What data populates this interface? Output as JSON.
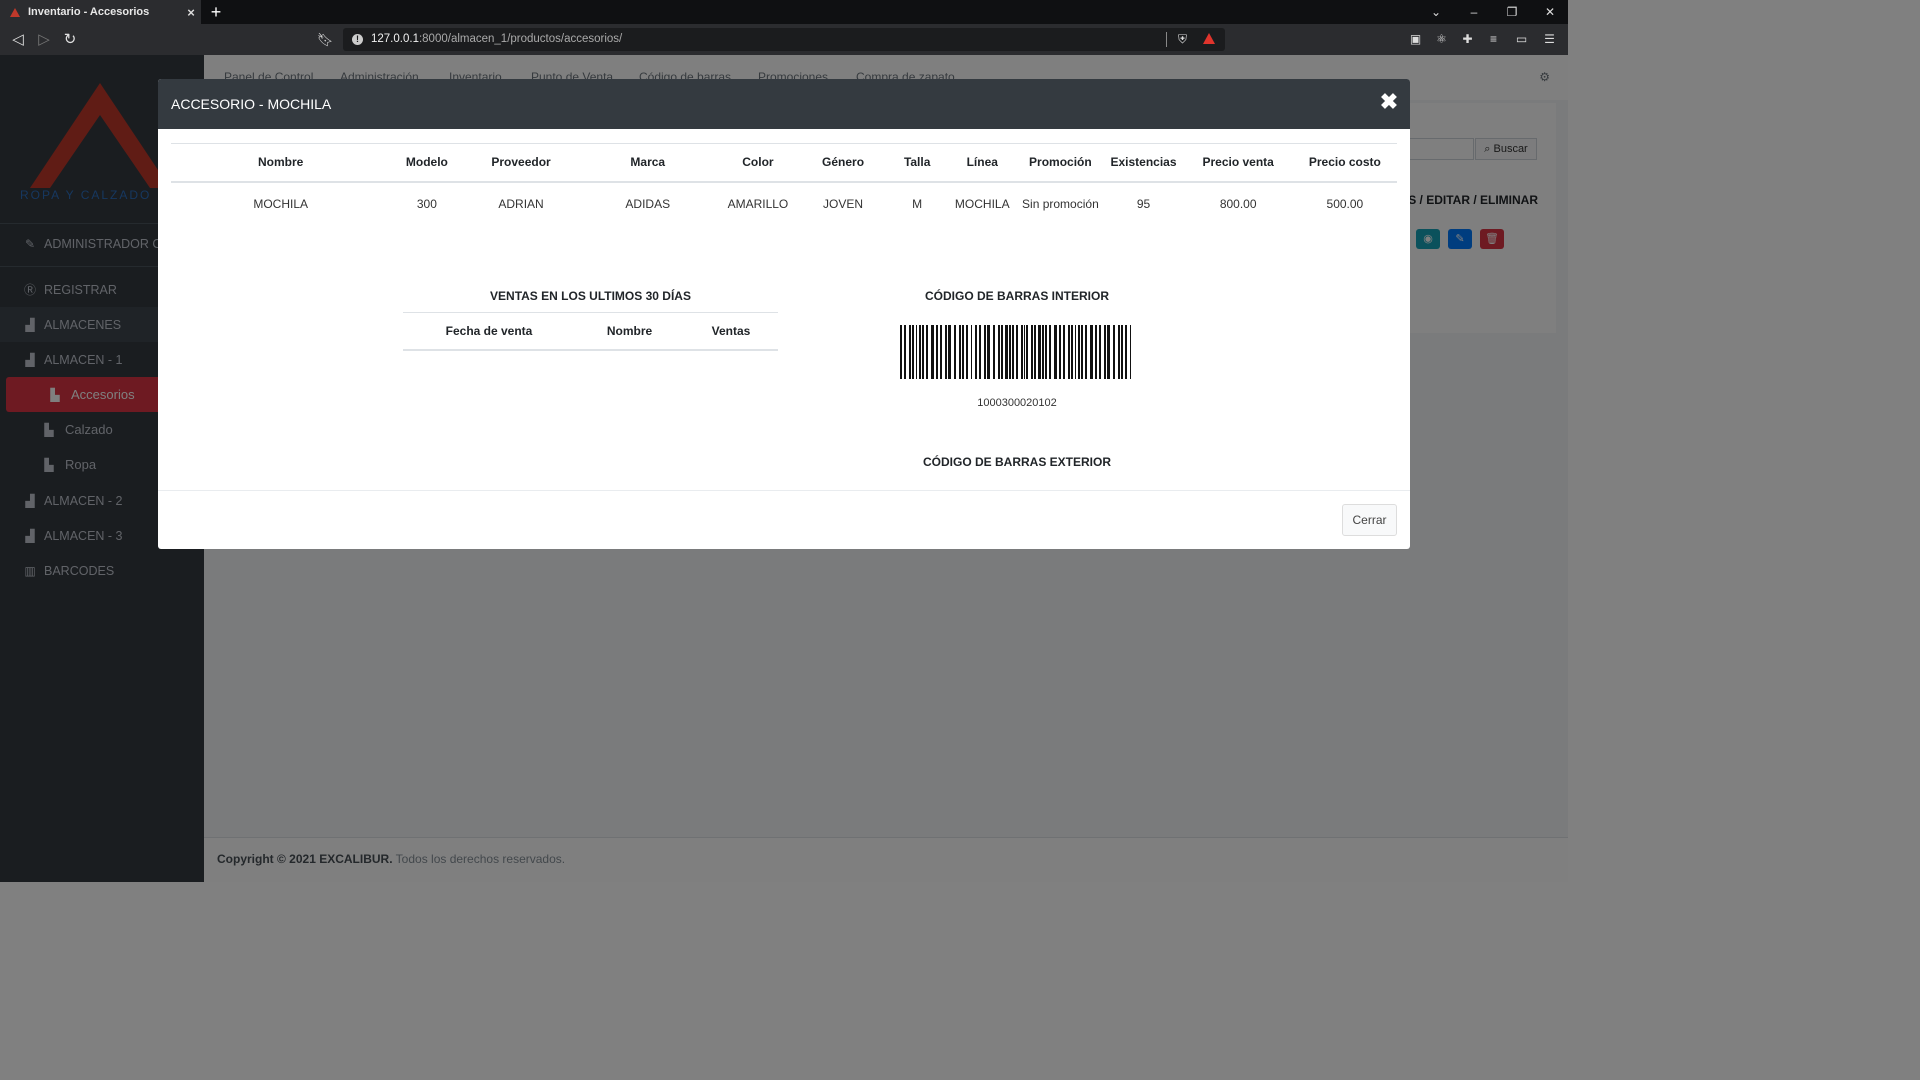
{
  "browser": {
    "tab_title": "Inventario - Accesorios",
    "tab_close": "×",
    "new_tab": "+",
    "url_host": "127.0.0.1",
    "url_path": ":8000/almacen_1/productos/accesorios/",
    "window_controls": [
      "⌄",
      "–",
      "❐",
      "✕"
    ]
  },
  "sidebar": {
    "logo_text": "ROPA Y CALZADO",
    "user": "ADMINISTRADOR CARL",
    "items": [
      {
        "label": "REGISTRAR",
        "icon": "register-icon"
      },
      {
        "label": "ALMACENES",
        "icon": "warehouse-icon"
      },
      {
        "label": "ALMACEN - 1",
        "icon": "warehouse-icon"
      },
      {
        "label": "Accesorios",
        "icon": "dolly-icon"
      },
      {
        "label": "Calzado",
        "icon": "dolly-icon"
      },
      {
        "label": "Ropa",
        "icon": "dolly-icon"
      },
      {
        "label": "ALMACEN - 2",
        "icon": "warehouse-icon"
      },
      {
        "label": "ALMACEN - 3",
        "icon": "warehouse-icon"
      },
      {
        "label": "BARCODES",
        "icon": "barcode-icon"
      }
    ]
  },
  "topnav": {
    "items": [
      "Panel de Control",
      "Administración",
      "Inventario",
      "Punto de Venta",
      "Código de barras",
      "Promociones",
      "Compra de zapato"
    ]
  },
  "content": {
    "search_button": "Buscar",
    "actions_header": "ÁS / EDITAR / ELIMINAR"
  },
  "footer": {
    "copyright": "Copyright © 2021 EXCALIBUR.",
    "rights": "Todos los derechos reservados."
  },
  "modal": {
    "title": "ACCESORIO - MOCHILA",
    "close_symbol": "✖",
    "product_table": {
      "headers": [
        "Nombre",
        "Modelo",
        "Proveedor",
        "Marca",
        "Color",
        "Género",
        "Talla",
        "Línea",
        "Promoción",
        "Existencias",
        "Precio venta",
        "Precio costo"
      ],
      "row": [
        "MOCHILA",
        "300",
        "ADRIAN",
        "ADIDAS",
        "AMARILLO",
        "JOVEN",
        "M",
        "MOCHILA",
        "Sin promoción",
        "95",
        "800.00",
        "500.00"
      ]
    },
    "sales": {
      "title": "VENTAS EN LOS ULTIMOS 30 DÍAS",
      "headers": [
        "Fecha de venta",
        "Nombre",
        "Ventas"
      ]
    },
    "barcode_interior": {
      "title": "CÓDIGO DE BARRAS INTERIOR",
      "number": "1000300020102"
    },
    "barcode_exterior": {
      "title": "CÓDIGO DE BARRAS EXTERIOR"
    },
    "close_button": "Cerrar"
  }
}
